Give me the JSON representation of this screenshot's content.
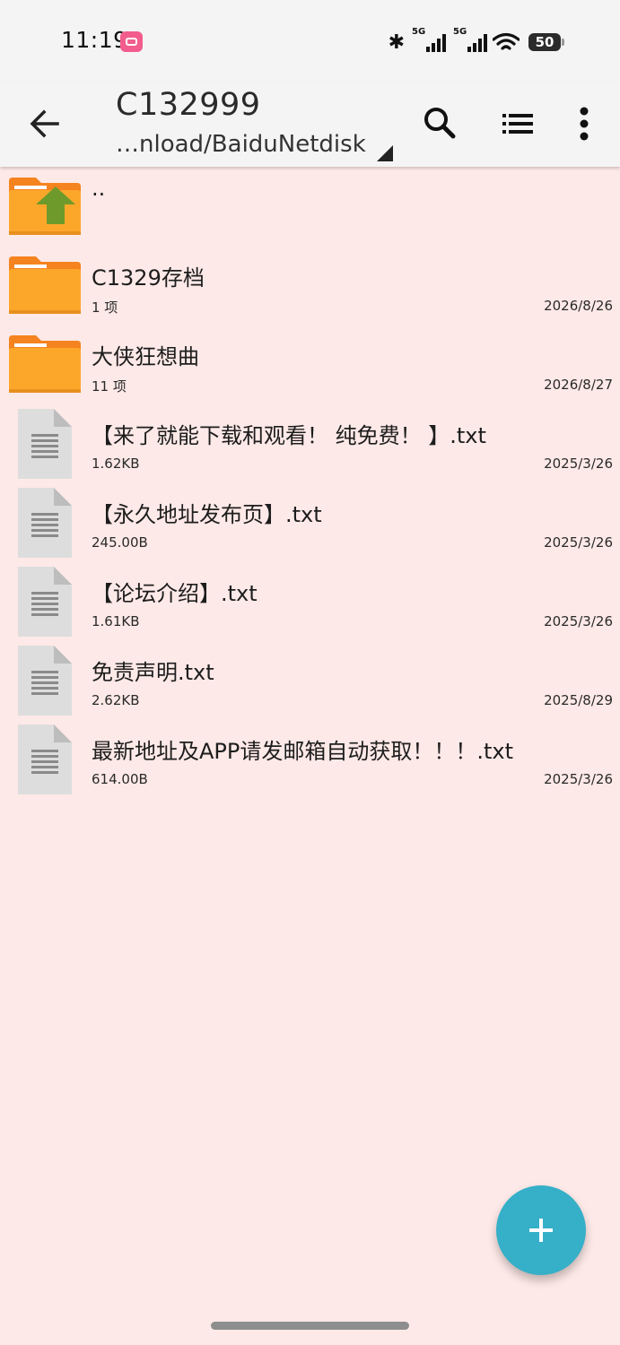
{
  "status_bar": {
    "time": "11:19",
    "bluetooth_icon": "bluetooth-icon",
    "signal_1": "5G",
    "signal_2": "5G",
    "battery_level": "50"
  },
  "toolbar": {
    "back_icon": "arrow-back-icon",
    "title": "C132999",
    "path": "…nload/BaiduNetdisk",
    "search_icon": "search-icon",
    "list_view_icon": "list-view-icon",
    "more_icon": "more-vert-icon"
  },
  "colors": {
    "background": "#FDE9E7",
    "toolbar": "#F4F4F4",
    "folder": "#FDA72A",
    "folder_tab": "#F5831F",
    "up_arrow": "#6E9A2B",
    "fab": "#36AFC8",
    "doc": "#DDDDDD"
  },
  "files": [
    {
      "type": "parent",
      "name": "..",
      "meta": "",
      "date": ""
    },
    {
      "type": "folder",
      "name": "C1329存档",
      "meta": "1 项",
      "date": "2026/8/26"
    },
    {
      "type": "folder",
      "name": "大侠狂想曲",
      "meta": "11 项",
      "date": "2026/8/27"
    },
    {
      "type": "file",
      "name": "【来了就能下载和观看！ 纯免费！ 】.txt",
      "meta": "1.62KB",
      "date": "2025/3/26"
    },
    {
      "type": "file",
      "name": "【永久地址发布页】.txt",
      "meta": "245.00B",
      "date": "2025/3/26"
    },
    {
      "type": "file",
      "name": "【论坛介绍】.txt",
      "meta": "1.61KB",
      "date": "2025/3/26"
    },
    {
      "type": "file",
      "name": "免责声明.txt",
      "meta": "2.62KB",
      "date": "2025/8/29"
    },
    {
      "type": "file",
      "name": "最新地址及APP请发邮箱自动获取！！！.txt",
      "meta": "614.00B",
      "date": "2025/3/26"
    }
  ],
  "fab": {
    "icon": "add-icon"
  }
}
